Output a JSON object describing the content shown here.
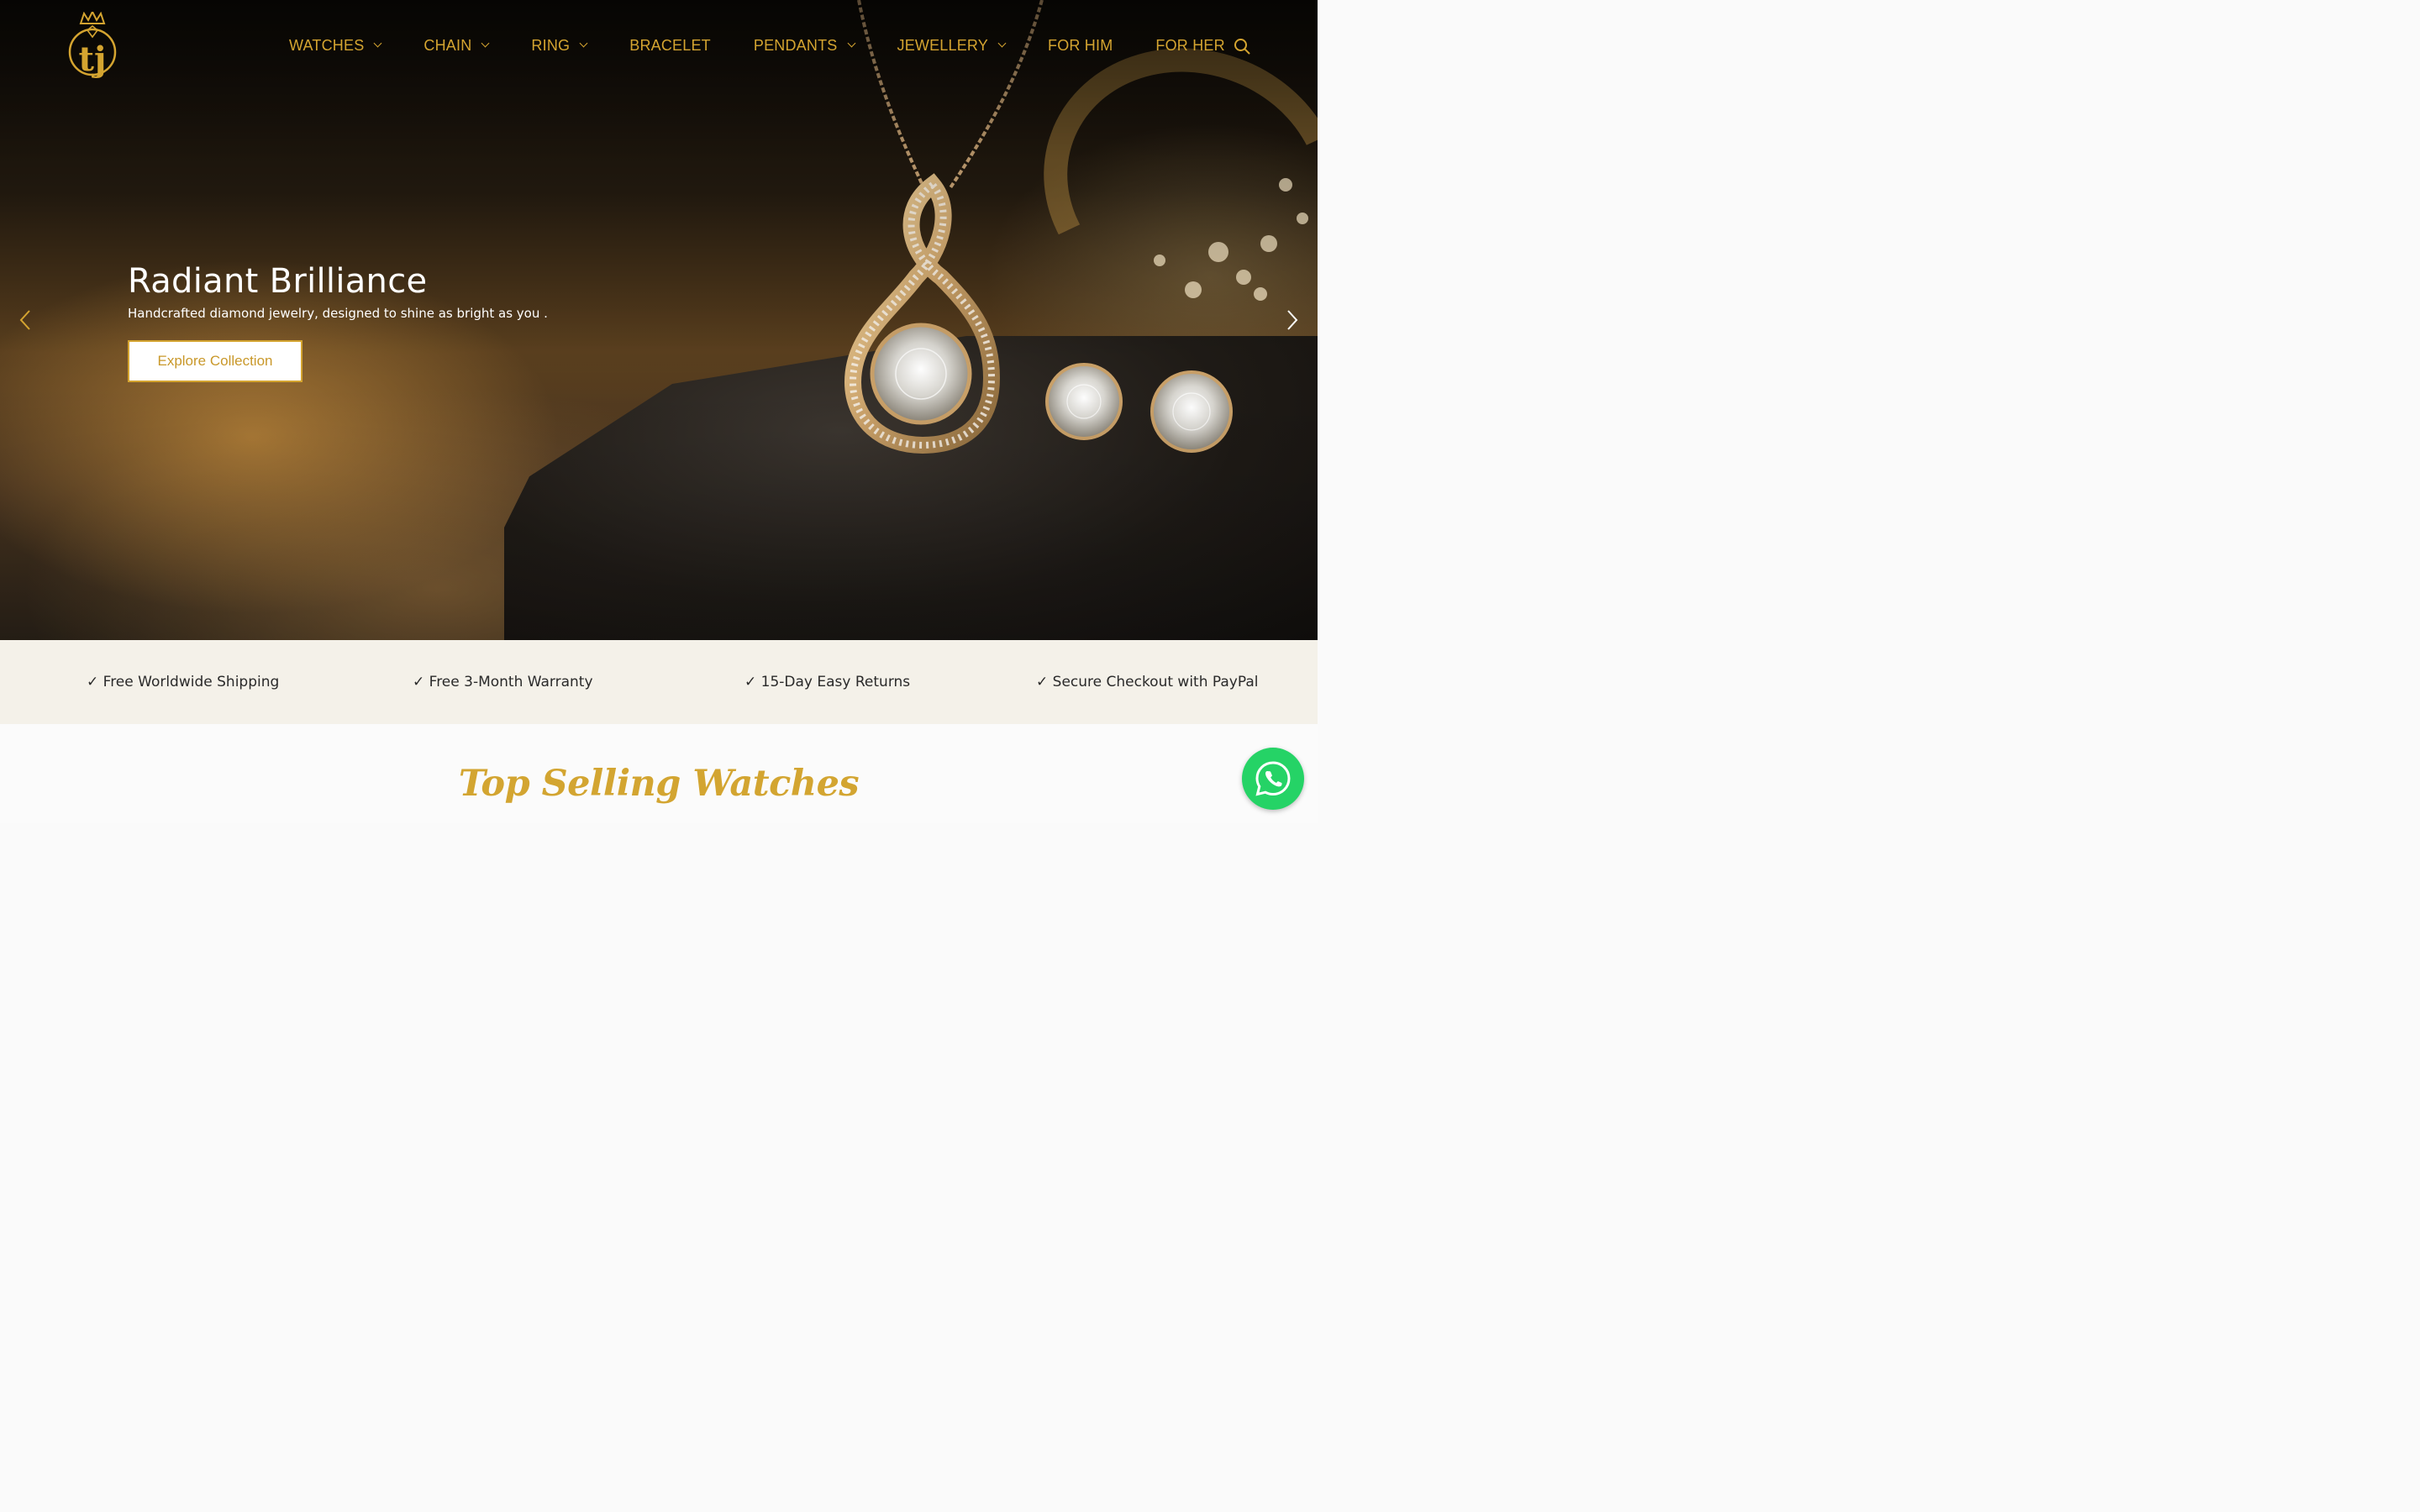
{
  "brand": {
    "logo_text": "tj",
    "accent_color": "#d4a430"
  },
  "nav": {
    "items": [
      {
        "label": "WATCHES",
        "dropdown": true
      },
      {
        "label": "CHAIN",
        "dropdown": true
      },
      {
        "label": "RING",
        "dropdown": true
      },
      {
        "label": "BRACELET",
        "dropdown": false
      },
      {
        "label": "PENDANTS",
        "dropdown": true
      },
      {
        "label": "JEWELLERY",
        "dropdown": true
      },
      {
        "label": "FOR HIM",
        "dropdown": false
      },
      {
        "label": "FOR HER",
        "dropdown": false
      }
    ],
    "search_icon": "search-icon"
  },
  "hero": {
    "title": "Radiant Brilliance",
    "subtitle": "Handcrafted diamond jewelry, designed to shine as bright as you .",
    "cta_label": "Explore Collection",
    "prev_icon": "chevron-left-icon",
    "next_icon": "chevron-right-icon"
  },
  "benefits": [
    "✓ Free Worldwide Shipping",
    "✓ Free 3-Month Warranty",
    "✓ 15-Day Easy Returns",
    "✓ Secure Checkout with PayPal"
  ],
  "section": {
    "title": "Top Selling Watches"
  },
  "chat": {
    "icon": "whatsapp-icon",
    "color": "#25d366"
  }
}
